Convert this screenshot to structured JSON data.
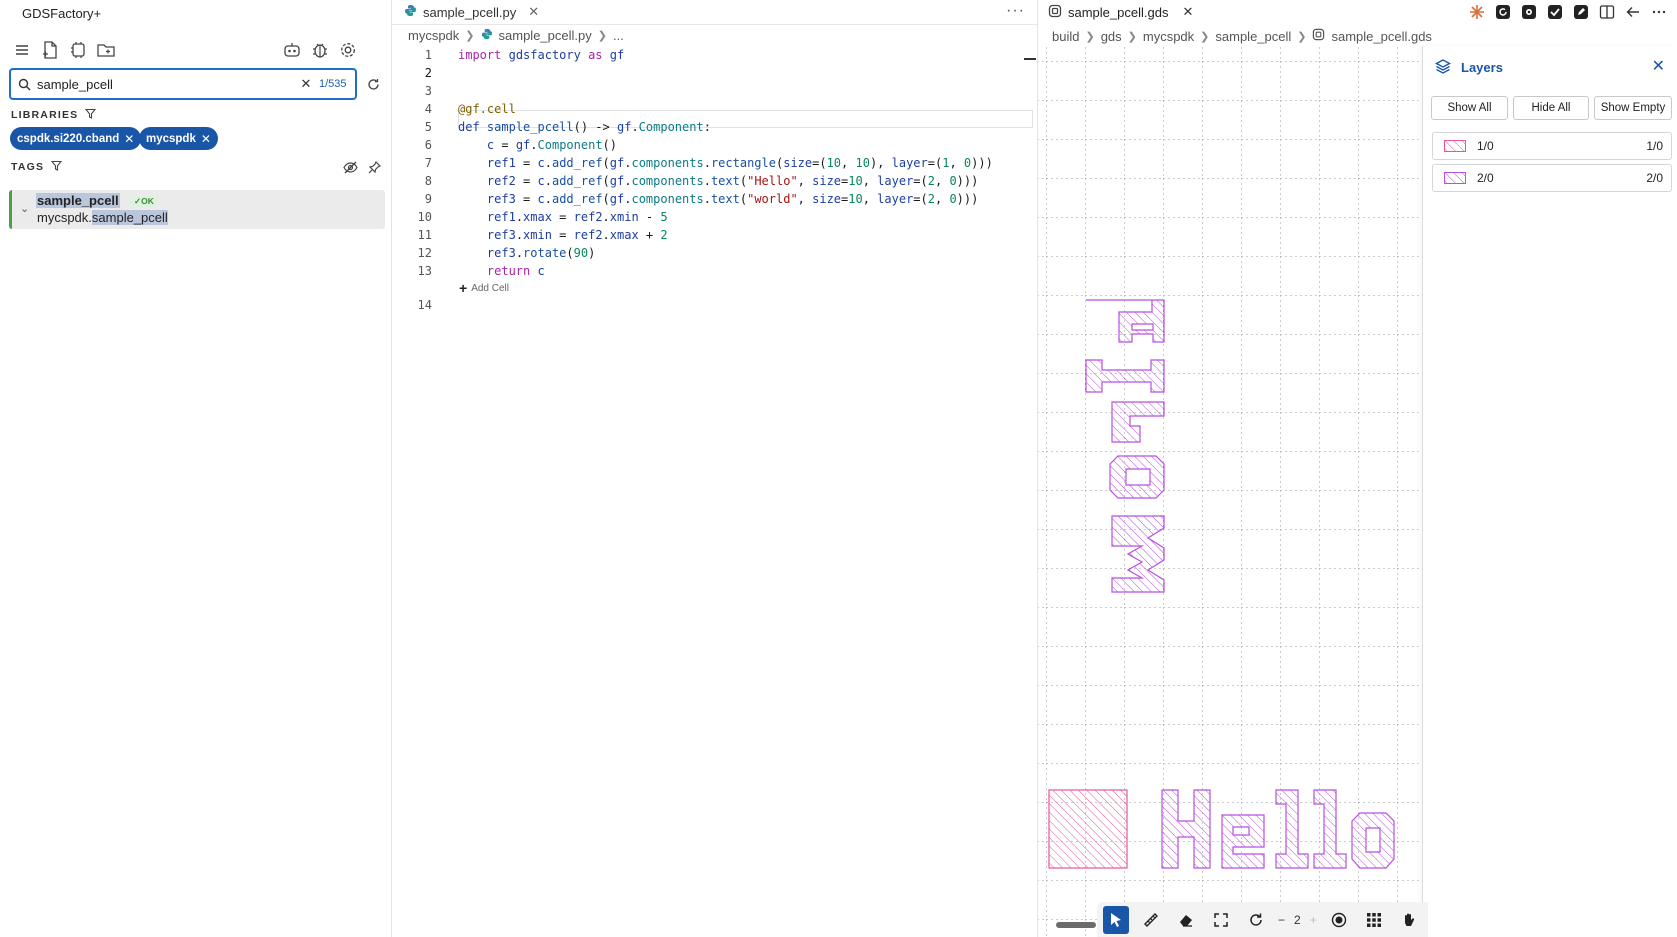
{
  "app": {
    "title": "GDSFactory+"
  },
  "sidebar": {
    "search": {
      "value": "sample_pcell",
      "placeholder": "Search",
      "count": "1/535"
    },
    "libraries_label": "LIBRARIES",
    "tags_label": "TAGS",
    "library_chips": [
      {
        "label": "cspdk.si220.cband"
      },
      {
        "label": "mycspdk"
      }
    ],
    "result": {
      "name": "sample_pcell",
      "status": "✓OK",
      "path_prefix": "mycspdk.",
      "path_highlight": "sample_pcell"
    }
  },
  "editor": {
    "tab": {
      "label": "sample_pcell.py"
    },
    "more": "···",
    "breadcrumb": [
      "mycspdk",
      "sample_pcell.py",
      "..."
    ],
    "line_numbers": [
      "1",
      "2",
      "3",
      "4",
      "5",
      "6",
      "7",
      "8",
      "9",
      "10",
      "11",
      "12",
      "13",
      "14"
    ],
    "active_line": "2",
    "add_cell_label": "Add Cell"
  },
  "viewer": {
    "tab": {
      "label": "sample_pcell.gds"
    },
    "breadcrumb": [
      "build",
      "gds",
      "mycspdk",
      "sample_pcell",
      "sample_pcell.gds"
    ],
    "layers_panel": {
      "title": "Layers",
      "show_all": "Show All",
      "hide_all": "Hide All",
      "show_empty": "Show Empty",
      "layers": [
        {
          "name": "1/0",
          "id": "1/0",
          "color": "#e8559a"
        },
        {
          "name": "2/0",
          "id": "2/0",
          "color": "#b84fe0"
        }
      ]
    },
    "zoom": {
      "minus": "−",
      "value": "2",
      "plus": "+"
    }
  },
  "colors": {
    "accent": "#1a56a8",
    "search_border": "#1f6fc9",
    "ok_green": "#4da04a",
    "layer_1_0": "#e8559a",
    "layer_2_0": "#b84fe0"
  }
}
